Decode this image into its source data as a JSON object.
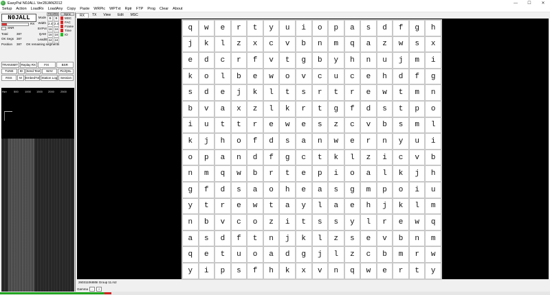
{
  "window": {
    "title": "EasyPal  N0JALL  Ver28JAN2012",
    "min": "—",
    "max": "☐",
    "close": "✕"
  },
  "menu": [
    "Setup",
    "Action",
    "LoadRx",
    "LoadAny",
    "Copy",
    "Paste",
    "WRPic",
    "WPTxt",
    "Rptr",
    "FTP",
    "Prog",
    "Clear",
    "About"
  ],
  "left": {
    "callsign": "N0JALL",
    "rx_label": "RX",
    "sn_label": "SNR",
    "stats": [
      {
        "k": "Total",
        "v": "387"
      },
      {
        "k": "OK Segs",
        "v": "387"
      },
      {
        "k": "Position",
        "v": "387",
        "note": "OK remaining segments"
      }
    ],
    "tx_hdr": "TX",
    "rx_hdr": "RX",
    "mode_rows": [
      {
        "k": "Mode",
        "tx": "B",
        "rx": "B"
      },
      {
        "k": "Width",
        "tx": "2.4",
        "rx": "2.4"
      },
      {
        "k": "ErrPot",
        "tx": "16",
        "rx": "16"
      },
      {
        "k": "QAM",
        "tx": "16",
        "rx": "16"
      },
      {
        "k": "Lead/Err",
        "tx": "24",
        "rx": "24"
      }
    ],
    "stat_hdr": "Sync",
    "status_items": [
      {
        "label": "MSC",
        "ok": false
      },
      {
        "label": "FAC",
        "ok": false
      },
      {
        "label": "Frame",
        "ok": false
      },
      {
        "label": "Time",
        "ok": false
      },
      {
        "label": "IO",
        "ok": true
      }
    ],
    "buttons": [
      [
        "TRANSMIT",
        "Replay RX",
        "FIX",
        "BSR"
      ],
      [
        "TUNE",
        "ID",
        "Send Text",
        "WAV",
        "Pic/QSL"
      ],
      [
        "RSS",
        "M",
        "EmbedTxt",
        "Station Log",
        "Session"
      ]
    ],
    "spectrum_ticks": [
      "Hz>",
      "500",
      "1000",
      "1500",
      "2000",
      "2500"
    ]
  },
  "tabs": [
    "RX",
    "TX",
    "View",
    "Edit",
    "MSC"
  ],
  "grid": {
    "rows": [
      [
        "q",
        "w",
        "e",
        "r",
        "t",
        "y",
        "u",
        "i",
        "o",
        "p",
        "a",
        "s",
        "d",
        "f",
        "g",
        "h"
      ],
      [
        "j",
        "k",
        "l",
        "z",
        "x",
        "c",
        "v",
        "b",
        "n",
        "m",
        "q",
        "a",
        "z",
        "w",
        "s",
        "x"
      ],
      [
        "e",
        "d",
        "c",
        "r",
        "f",
        "v",
        "t",
        "g",
        "b",
        "y",
        "h",
        "n",
        "u",
        "j",
        "m",
        "i"
      ],
      [
        "k",
        "o",
        "l",
        "b",
        "e",
        "w",
        "o",
        "v",
        "c",
        "u",
        "c",
        "e",
        "h",
        "d",
        "f",
        "g"
      ],
      [
        "s",
        "d",
        "e",
        "j",
        "k",
        "l",
        "t",
        "s",
        "r",
        "t",
        "r",
        "e",
        "w",
        "t",
        "m",
        "n"
      ],
      [
        "b",
        "v",
        "a",
        "x",
        "z",
        "l",
        "k",
        "r",
        "t",
        "g",
        "f",
        "d",
        "s",
        "t",
        "p",
        "o"
      ],
      [
        "i",
        "u",
        "t",
        "t",
        "r",
        "e",
        "w",
        "e",
        "s",
        "z",
        "c",
        "v",
        "b",
        "s",
        "m",
        "l"
      ],
      [
        "k",
        "j",
        "h",
        "o",
        "f",
        "d",
        "s",
        "a",
        "n",
        "w",
        "e",
        "r",
        "n",
        "y",
        "u",
        "i"
      ],
      [
        "o",
        "p",
        "a",
        "n",
        "d",
        "f",
        "g",
        "c",
        "t",
        "k",
        "l",
        "z",
        "i",
        "c",
        "v",
        "b"
      ],
      [
        "n",
        "m",
        "q",
        "w",
        "b",
        "r",
        "t",
        "e",
        "p",
        "i",
        "o",
        "a",
        "l",
        "k",
        "j",
        "h"
      ],
      [
        "g",
        "f",
        "d",
        "s",
        "a",
        "o",
        "h",
        "e",
        "a",
        "s",
        "g",
        "m",
        "p",
        "o",
        "i",
        "u"
      ],
      [
        "y",
        "t",
        "r",
        "e",
        "w",
        "t",
        "a",
        "y",
        "l",
        "a",
        "e",
        "h",
        "j",
        "k",
        "l",
        "m"
      ],
      [
        "n",
        "b",
        "v",
        "c",
        "o",
        "z",
        "i",
        "t",
        "s",
        "s",
        "y",
        "l",
        "r",
        "e",
        "w",
        "q"
      ],
      [
        "a",
        "s",
        "d",
        "f",
        "t",
        "n",
        "j",
        "k",
        "l",
        "z",
        "s",
        "e",
        "v",
        "b",
        "n",
        "m"
      ],
      [
        "q",
        "e",
        "t",
        "u",
        "o",
        "a",
        "d",
        "g",
        "j",
        "l",
        "z",
        "c",
        "b",
        "m",
        "r",
        "w"
      ],
      [
        "y",
        "i",
        "p",
        "s",
        "f",
        "h",
        "k",
        "x",
        "v",
        "n",
        "q",
        "w",
        "e",
        "r",
        "t",
        "y"
      ]
    ]
  },
  "status_text": "26031106885I Group 11.rs2",
  "gamma_label": "Gamma",
  "gamma_minus": "-",
  "gamma_plus": "+",
  "progress": {
    "green_fraction": 0.19,
    "red_fraction": 0.012
  },
  "colors": {
    "accent_green": "#1ea51e",
    "accent_red": "#d41f1f",
    "viewer_bg": "#000000"
  }
}
